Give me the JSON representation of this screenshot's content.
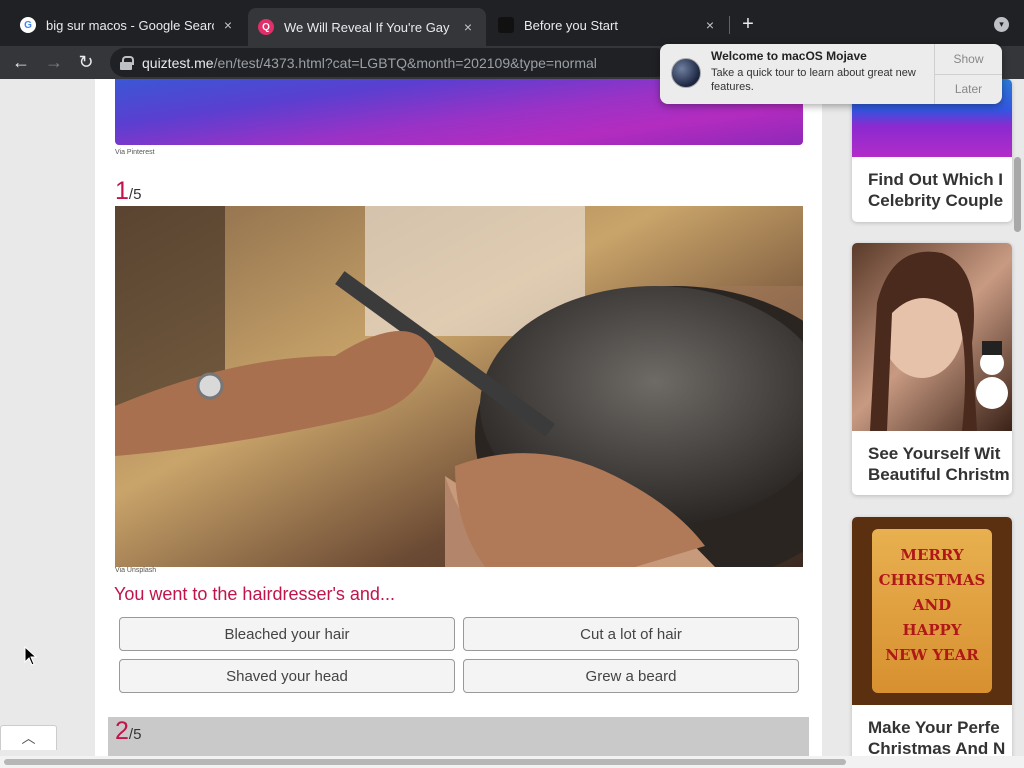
{
  "browser": {
    "tabs": [
      {
        "title": "big sur macos - Google Search",
        "icon": "google-icon",
        "active": false
      },
      {
        "title": "We Will Reveal If You're Gay Ba",
        "icon": "quiztest-icon",
        "active": true
      },
      {
        "title": "Before you Start",
        "icon": "site-icon",
        "active": false
      }
    ],
    "new_tab": "+",
    "close_glyph": "×",
    "url": {
      "host": "quiztest.me",
      "path": "/en/test/4373.html?cat=LGBTQ&month=202109&type=normal"
    }
  },
  "notification": {
    "title": "Welcome to macOS Mojave",
    "text": "Take a quick tour to learn about great new features.",
    "show_label": "Show",
    "later_label": "Later"
  },
  "quiz": {
    "prev_caption": "Via Pinterest",
    "q1": {
      "number": "1",
      "total": "/5",
      "image_caption": "Via Unsplash",
      "question": "You went to the hairdresser's and...",
      "answers": [
        "Bleached your hair",
        "Cut a lot of hair",
        "Shaved your head",
        "Grew a beard"
      ]
    },
    "q2": {
      "number": "2",
      "total": "/5"
    }
  },
  "sidebar": {
    "cards": [
      {
        "line1": "Find Out Which I",
        "line2": "Celebrity Couple"
      },
      {
        "line1": "See Yourself Wit",
        "line2": "Beautiful Christm"
      },
      {
        "line1": "Make Your Perfe",
        "line2": "Christmas And N"
      }
    ],
    "xmas_lines": [
      "MERRY",
      "CHRISTMAS",
      "AND",
      "HAPPY",
      "NEW YEAR"
    ]
  },
  "colors": {
    "accent": "#c0144a",
    "chrome": "#202124",
    "toolbar": "#35363a"
  }
}
